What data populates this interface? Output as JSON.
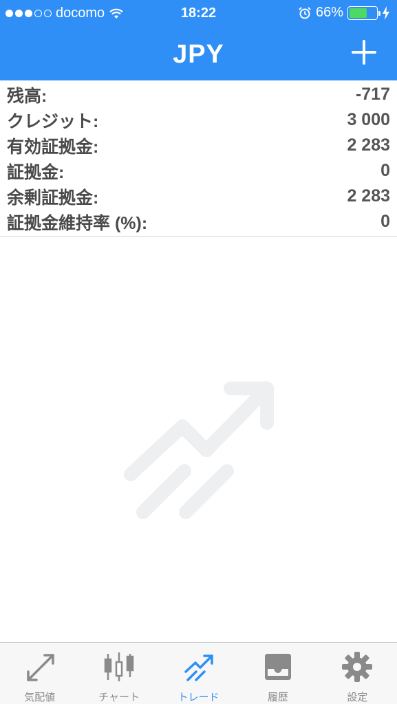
{
  "status_bar": {
    "carrier": "docomo",
    "time": "18:22",
    "battery_percent": "66%",
    "battery_level": 0.66
  },
  "nav": {
    "title": "JPY"
  },
  "account": {
    "rows": [
      {
        "label": "残高:",
        "value": "-717"
      },
      {
        "label": "クレジット:",
        "value": "3 000"
      },
      {
        "label": "有効証拠金:",
        "value": "2 283"
      },
      {
        "label": "証拠金:",
        "value": "0"
      },
      {
        "label": "余剰証拠金:",
        "value": "2 283"
      },
      {
        "label": "証拠金維持率 (%):",
        "value": "0"
      }
    ]
  },
  "tabs": [
    {
      "label": "気配値",
      "icon": "quotes-arrows-icon"
    },
    {
      "label": "チャート",
      "icon": "candlestick-chart-icon"
    },
    {
      "label": "トレード",
      "icon": "trade-trend-icon",
      "active": true
    },
    {
      "label": "履歴",
      "icon": "history-inbox-icon"
    },
    {
      "label": "設定",
      "icon": "settings-gear-icon"
    }
  ],
  "colors": {
    "primary": "#2f8ff6",
    "tab_inactive": "#8a8a8a",
    "battery_fill": "#4cd964"
  }
}
